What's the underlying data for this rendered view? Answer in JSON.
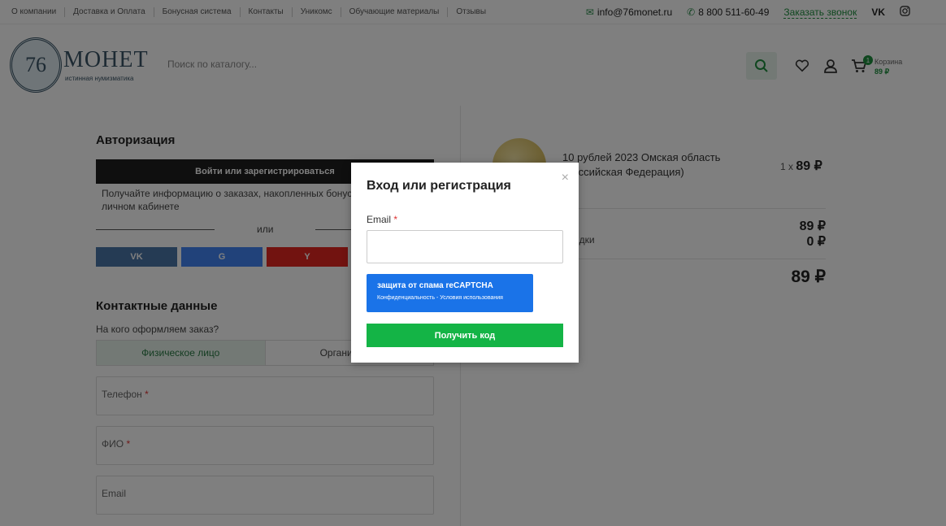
{
  "topbar": {
    "nav": [
      "О компании",
      "Доставка и Оплата",
      "Бонусная система",
      "Контакты",
      "Уникомс",
      "Обучающие материалы",
      "Отзывы"
    ],
    "email": "info@76monet.ru",
    "phone": "8 800 511-60-49",
    "callback": "Заказать звонок",
    "vk": "VK"
  },
  "header": {
    "logo_number": "76",
    "logo_name": "МОНЕТ",
    "logo_tagline": "истинная нумизматика",
    "search_placeholder": "Поиск по каталогу...",
    "cart_label": "Корзина",
    "cart_sum": "89 ₽",
    "cart_count": "1"
  },
  "auth": {
    "title": "Авторизация",
    "login_button": "Войти или зарегистрироваться",
    "info": "Получайте информацию о заказах, накопленных бонусах и скидках в личном кабинете",
    "or": "или",
    "social": [
      "VK",
      "G",
      "Y"
    ]
  },
  "contacts": {
    "title": "Контактные данные",
    "subtitle": "На кого оформляем заказ?",
    "tab_person": "Физическое лицо",
    "tab_org": "Организация",
    "phone_label": "Телефон",
    "fio_label": "ФИО",
    "email_label": "Email"
  },
  "order": {
    "product": "10 рублей 2023 Омская область (Российская Федерация)",
    "qty": "1 x",
    "price": "89 ₽",
    "subtotal": "89 ₽",
    "discount": "0 ₽",
    "discount_label": "Скидки",
    "total": "89 ₽"
  },
  "modal": {
    "title": "Вход или регистрация",
    "email_label": "Email",
    "required_mark": "*",
    "captcha_line1": "защита от спама reCAPTCHA",
    "captcha_line2": "Конфиденциальность - Условия использования",
    "submit": "Получить код",
    "close": "×"
  },
  "colors": {
    "accent": "#14b446",
    "captcha": "#1a73e8",
    "dark_button": "#1e1e1e",
    "vk": "#4a76a8",
    "google": "#4285f4",
    "yandex": "#e52620"
  }
}
